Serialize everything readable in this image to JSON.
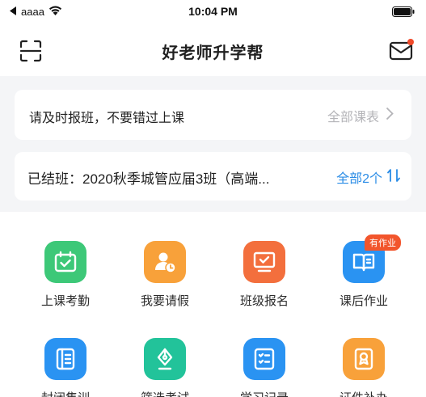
{
  "status_bar": {
    "carrier": "aaaa",
    "time": "10:04 PM"
  },
  "nav": {
    "title": "好老师升学帮"
  },
  "notice_card": {
    "text": "请及时报班，不要错过上课",
    "link_label": "全部课表"
  },
  "class_card": {
    "text": "已结班：2020秋季城管应届3班（高端...",
    "link_label": "全部2个"
  },
  "grid": {
    "items": [
      {
        "label": "上课考勤",
        "icon": "attendance-icon",
        "color": "#3dc878"
      },
      {
        "label": "我要请假",
        "icon": "leave-request-icon",
        "color": "#f8a13a"
      },
      {
        "label": "班级报名",
        "icon": "class-signup-icon",
        "color": "#f36f3d"
      },
      {
        "label": "课后作业",
        "icon": "homework-icon",
        "color": "#2a93f2",
        "badge": "有作业"
      },
      {
        "label": "封闭集训",
        "icon": "training-icon",
        "color": "#2a93f2"
      },
      {
        "label": "筛选考试",
        "icon": "exam-icon",
        "color": "#22c39a"
      },
      {
        "label": "学习记录",
        "icon": "study-record-icon",
        "color": "#2a93f2"
      },
      {
        "label": "证件补办",
        "icon": "certificate-icon",
        "color": "#f8a13a"
      }
    ]
  },
  "colors": {
    "accent_blue": "#2a8ce6",
    "badge_red": "#f2552c",
    "page_bg": "#f4f5f7"
  }
}
